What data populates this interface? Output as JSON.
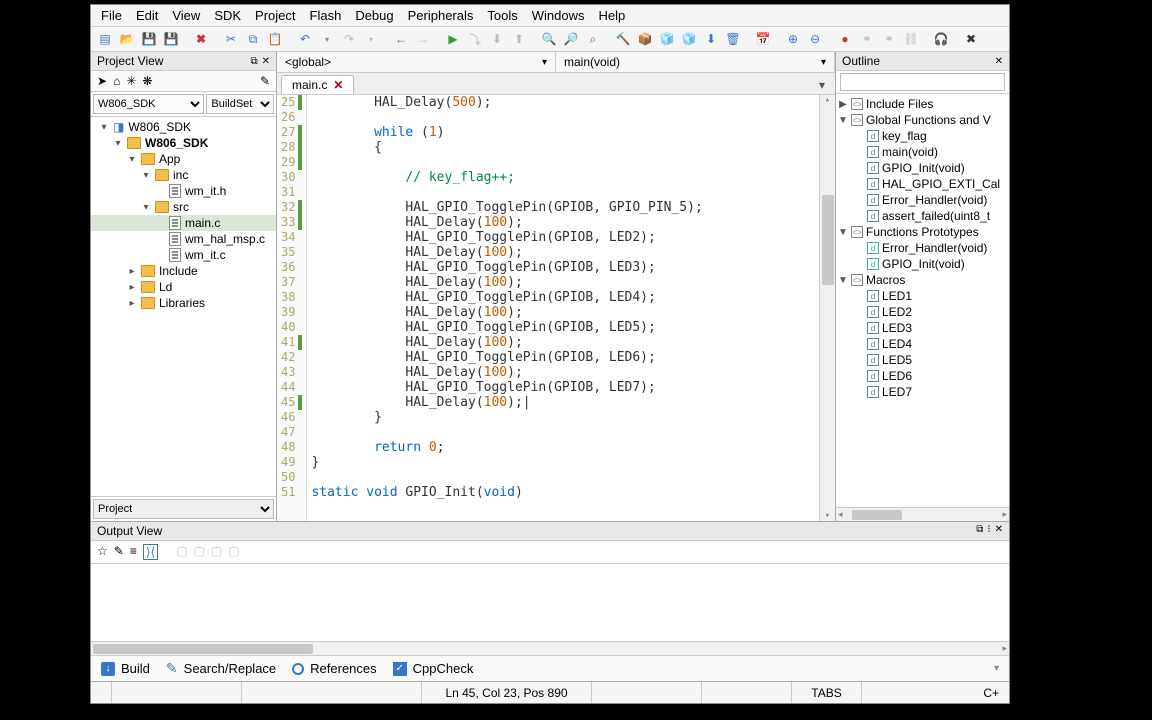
{
  "menu": [
    "File",
    "Edit",
    "View",
    "SDK",
    "Project",
    "Flash",
    "Debug",
    "Peripherals",
    "Tools",
    "Windows",
    "Help"
  ],
  "projectView": {
    "title": "Project View",
    "sdkSelector": "W806_SDK",
    "buildSelector": "BuildSet",
    "tree": {
      "root": "W806_SDK",
      "project": "W806_SDK",
      "app": "App",
      "inc": "inc",
      "inc_files": [
        "wm_it.h"
      ],
      "src": "src",
      "src_files": [
        "main.c",
        "wm_hal_msp.c",
        "wm_it.c"
      ],
      "others": [
        "Include",
        "Ld",
        "Libraries"
      ]
    },
    "footer": "Project"
  },
  "editor": {
    "scopeLeft": "<global>",
    "scopeRight": "main(void)",
    "tab": "main.c",
    "firstLine": 25,
    "code": [
      {
        "n": 25,
        "t": "        HAL_Delay(500);",
        "m": 1
      },
      {
        "n": 26,
        "t": "",
        "m": 0
      },
      {
        "n": 27,
        "t": "        while (1)",
        "m": 1
      },
      {
        "n": 28,
        "t": "        {",
        "m": 1
      },
      {
        "n": 29,
        "t": "",
        "m": 1
      },
      {
        "n": 30,
        "t": "            // key_flag++;",
        "m": 0
      },
      {
        "n": 31,
        "t": "",
        "m": 0
      },
      {
        "n": 32,
        "t": "            HAL_GPIO_TogglePin(GPIOB, GPIO_PIN_5);",
        "m": 1
      },
      {
        "n": 33,
        "t": "            HAL_Delay(100);",
        "m": 1
      },
      {
        "n": 34,
        "t": "            HAL_GPIO_TogglePin(GPIOB, LED2);",
        "m": 0
      },
      {
        "n": 35,
        "t": "            HAL_Delay(100);",
        "m": 0
      },
      {
        "n": 36,
        "t": "            HAL_GPIO_TogglePin(GPIOB, LED3);",
        "m": 0
      },
      {
        "n": 37,
        "t": "            HAL_Delay(100);",
        "m": 0
      },
      {
        "n": 38,
        "t": "            HAL_GPIO_TogglePin(GPIOB, LED4);",
        "m": 0
      },
      {
        "n": 39,
        "t": "            HAL_Delay(100);",
        "m": 0
      },
      {
        "n": 40,
        "t": "            HAL_GPIO_TogglePin(GPIOB, LED5);",
        "m": 0
      },
      {
        "n": 41,
        "t": "            HAL_Delay(100);",
        "m": 1
      },
      {
        "n": 42,
        "t": "            HAL_GPIO_TogglePin(GPIOB, LED6);",
        "m": 0
      },
      {
        "n": 43,
        "t": "            HAL_Delay(100);",
        "m": 0
      },
      {
        "n": 44,
        "t": "            HAL_GPIO_TogglePin(GPIOB, LED7);",
        "m": 0
      },
      {
        "n": 45,
        "t": "            HAL_Delay(100);|",
        "m": 1
      },
      {
        "n": 46,
        "t": "        }",
        "m": 0
      },
      {
        "n": 47,
        "t": "",
        "m": 0
      },
      {
        "n": 48,
        "t": "        return 0;",
        "m": 0
      },
      {
        "n": 49,
        "t": "}",
        "m": 0
      },
      {
        "n": 50,
        "t": "",
        "m": 0
      },
      {
        "n": 51,
        "t": "static void GPIO_Init(void)",
        "m": 0
      }
    ]
  },
  "outline": {
    "title": "Outline",
    "groups": [
      {
        "exp": "▶",
        "label": "Include Files",
        "box": "<>"
      },
      {
        "exp": "▼",
        "label": "Global Functions and V",
        "box": "<>",
        "items": [
          {
            "box": "d",
            "label": "key_flag",
            "col": "blue"
          },
          {
            "box": "d",
            "label": "main(void)",
            "col": "blue"
          },
          {
            "box": "d",
            "label": "GPIO_Init(void)",
            "col": "blue"
          },
          {
            "box": "d",
            "label": "HAL_GPIO_EXTI_Cal",
            "col": "blue"
          },
          {
            "box": "d",
            "label": "Error_Handler(void)",
            "col": "blue"
          },
          {
            "box": "d",
            "label": "assert_failed(uint8_t",
            "col": "blue"
          }
        ]
      },
      {
        "exp": "▼",
        "label": "Functions Prototypes",
        "box": "<>",
        "items": [
          {
            "box": "d",
            "label": "Error_Handler(void)",
            "col": "cyan"
          },
          {
            "box": "d",
            "label": "GPIO_Init(void)",
            "col": "cyan"
          }
        ]
      },
      {
        "exp": "▼",
        "label": "Macros",
        "box": "<>",
        "items": [
          {
            "box": "d",
            "label": "LED1",
            "col": "blue"
          },
          {
            "box": "d",
            "label": "LED2",
            "col": "blue"
          },
          {
            "box": "d",
            "label": "LED3",
            "col": "blue"
          },
          {
            "box": "d",
            "label": "LED4",
            "col": "blue"
          },
          {
            "box": "d",
            "label": "LED5",
            "col": "blue"
          },
          {
            "box": "d",
            "label": "LED6",
            "col": "blue"
          },
          {
            "box": "d",
            "label": "LED7",
            "col": "blue"
          }
        ]
      }
    ]
  },
  "outputView": {
    "title": "Output View"
  },
  "bottomTabs": {
    "build": "Build",
    "search": "Search/Replace",
    "refs": "References",
    "cpp": "CppCheck"
  },
  "status": {
    "pos": "Ln 45, Col 23, Pos 890",
    "tabs": "TABS",
    "lang": "C+"
  }
}
